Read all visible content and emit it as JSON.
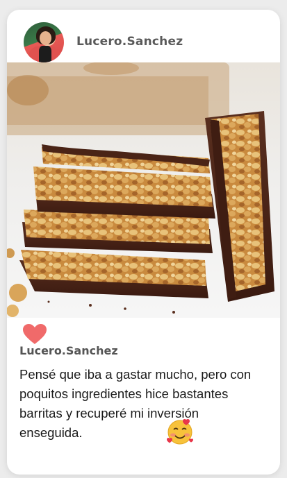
{
  "header": {
    "username": "Lucero.Sanchez",
    "avatar_icon": "profile-avatar"
  },
  "post": {
    "image_alt": "chocolate-dipped peanut bars",
    "like_icon": "heart-icon",
    "like_color": "#f06a6a",
    "caption_username": "Lucero.Sanchez",
    "caption_text": "Pensé que iba a gastar mucho, pero con poquitos ingredientes hice bastantes barritas y recuperé mi inversión enseguida.",
    "emoji_icon": "smiling-face-with-hearts-emoji"
  }
}
